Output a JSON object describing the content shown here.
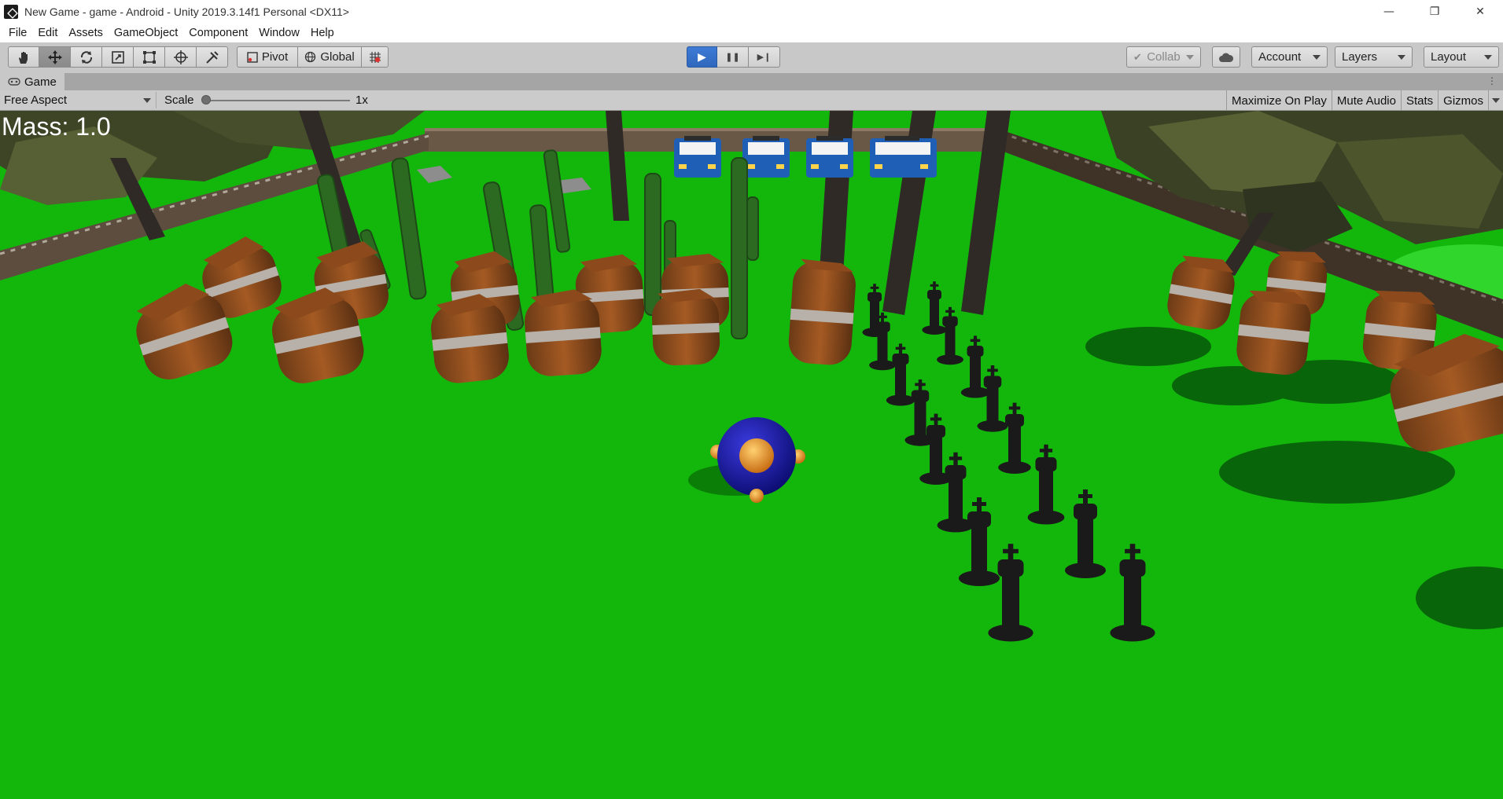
{
  "window": {
    "title": "New Game - game - Android - Unity 2019.3.14f1 Personal <DX11>",
    "controls": {
      "minimize": "—",
      "restore": "❐",
      "close": "✕"
    }
  },
  "menu": [
    "File",
    "Edit",
    "Assets",
    "GameObject",
    "Component",
    "Window",
    "Help"
  ],
  "toolbar": {
    "tools": [
      "hand-icon",
      "move-icon",
      "rotate-icon",
      "scale-icon",
      "rect-transform-icon",
      "transform-icon",
      "custom-tool-icon"
    ],
    "pivot_label": "Pivot",
    "global_label": "Global",
    "play": "▶",
    "pause": "❚❚",
    "step": "▶❙",
    "collab_label": "Collab",
    "account_label": "Account",
    "layers_label": "Layers",
    "layout_label": "Layout"
  },
  "game_view": {
    "tab_label": "Game",
    "aspect_label": "Free Aspect",
    "scale_label": "Scale",
    "scale_value": "1x",
    "toggles": [
      "Maximize On Play",
      "Mute Audio",
      "Stats",
      "Gizmos"
    ],
    "hud_text": "Mass: 1.0"
  },
  "colors": {
    "ground": "#13b70c",
    "play_active": "#3873cc",
    "ball": "#1c1aa8",
    "ball_accent": "#e8931c"
  }
}
